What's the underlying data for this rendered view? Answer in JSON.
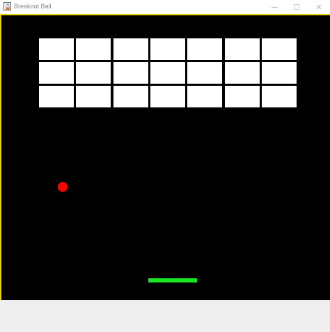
{
  "window": {
    "title": "Breakout Ball",
    "app_icon": "java-cup-icon",
    "buttons": {
      "minimize_icon": "minimize-icon",
      "maximize_icon": "maximize-icon",
      "close_icon": "close-icon",
      "close_label": "✕"
    },
    "border_color": "#e8d400"
  },
  "game": {
    "background_color": "#000000",
    "bricks": {
      "rows": 3,
      "columns": 7,
      "color": "#ffffff",
      "remaining": 21
    },
    "ball": {
      "color": "#ff0000"
    },
    "paddle": {
      "color": "#18e81f"
    }
  }
}
